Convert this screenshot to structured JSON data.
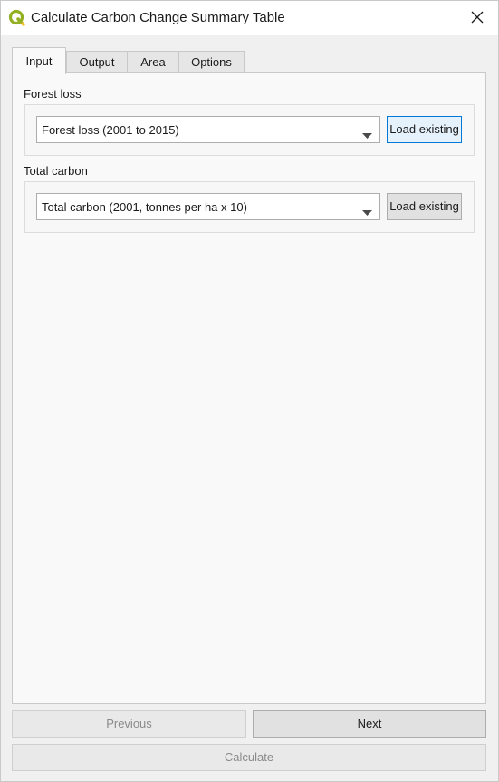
{
  "window": {
    "title": "Calculate Carbon Change Summary Table",
    "icon": "qgis-logo-icon",
    "close_icon": "close-icon"
  },
  "tabs": [
    {
      "label": "Input",
      "active": true
    },
    {
      "label": "Output",
      "active": false
    },
    {
      "label": "Area",
      "active": false
    },
    {
      "label": "Options",
      "active": false
    }
  ],
  "inputs": {
    "forest_loss": {
      "label": "Forest loss",
      "selected": "Forest loss (2001 to 2015)",
      "load_label": "Load existing"
    },
    "total_carbon": {
      "label": "Total carbon",
      "selected": "Total carbon (2001, tonnes per ha x 10)",
      "load_label": "Load existing"
    }
  },
  "footer": {
    "previous_label": "Previous",
    "next_label": "Next",
    "calculate_label": "Calculate"
  },
  "colors": {
    "focus_accent": "#0078d7",
    "qgis_green": "#93b023",
    "qgis_yellow": "#f0c330"
  }
}
